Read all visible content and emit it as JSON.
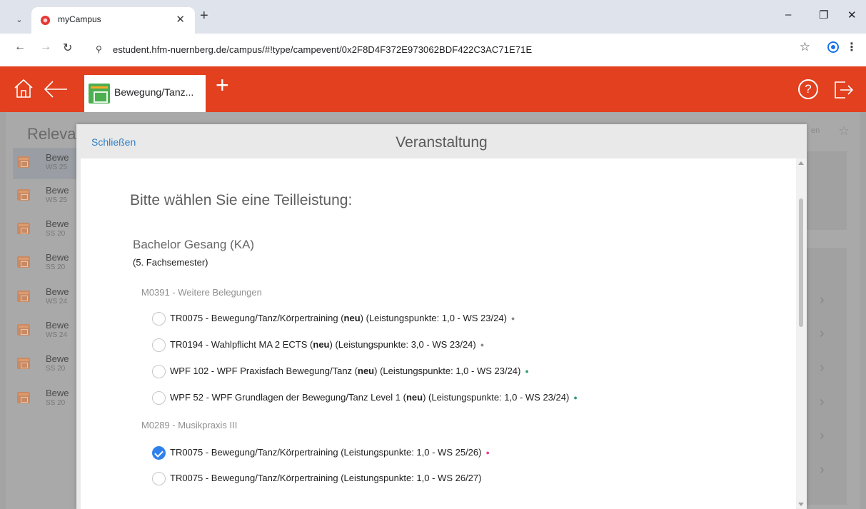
{
  "browser": {
    "tab_title": "myCampus",
    "tab_close": "✕",
    "new_tab": "+",
    "url": "estudent.hfm-nuernberg.de/campus/#!type/campevent/0x2F8D4F372E973062BDF422C3AC71E71E",
    "window_controls": {
      "minimize": "–",
      "restore": "❐",
      "close": "✕"
    },
    "icons": [
      "tab-search-icon",
      "favicon",
      "back-icon",
      "forward-icon",
      "reload-icon",
      "site-info-icon",
      "bookmark-star-icon",
      "profile-icon",
      "menu-icon"
    ]
  },
  "app_header": {
    "tab_label": "Bewegung/Tanz...",
    "add_label": "+",
    "help_label": "?",
    "accent": "#e2401f"
  },
  "background_page": {
    "title": "Releva",
    "items": [
      {
        "line1": "Bewe",
        "line2": "WS 25"
      },
      {
        "line1": "Bewe",
        "line2": "WS 25"
      },
      {
        "line1": "Bewe",
        "line2": "SS 20"
      },
      {
        "line1": "Bewe",
        "line2": "SS 20"
      },
      {
        "line1": "Bewe",
        "line2": "WS 24"
      },
      {
        "line1": "Bewe",
        "line2": "WS 24"
      },
      {
        "line1": "Bewe",
        "line2": "SS 20"
      },
      {
        "line1": "Bewe",
        "line2": "SS 20"
      }
    ],
    "right_hint": "en",
    "chevron": "›"
  },
  "modal": {
    "close_label": "Schließen",
    "title": "Veranstaltung",
    "prompt": "Bitte wählen Sie eine Teilleistung:",
    "program": "Bachelor Gesang (KA)",
    "semester": "(5. Fachsemester)",
    "modules": [
      {
        "label": "M0391 - Weitere Belegungen",
        "options": [
          {
            "prefix": "TR0075 - Bewegung/Tanz/Körpertraining ",
            "bold": "neu",
            "suffix": " (Leistungspunkte: 1,0 - WS 23/24)",
            "dot": "●",
            "dot_color": "#8a8a8a",
            "checked": false
          },
          {
            "prefix": "TR0194 - Wahlpflicht MA 2 ECTS ",
            "bold": "neu",
            "suffix": " (Leistungspunkte: 3,0 - WS 23/24)",
            "dot": "●",
            "dot_color": "#8a8a8a",
            "checked": false
          },
          {
            "prefix": "WPF 102 - WPF Praxisfach Bewegung/Tanz ",
            "bold": "neu",
            "suffix": " (Leistungspunkte: 1,0 - WS 23/24)",
            "dot": "●",
            "dot_color": "#2e9e6a",
            "checked": false
          },
          {
            "prefix": "WPF 52 - WPF Grundlagen der Bewegung/Tanz Level 1 ",
            "bold": "neu",
            "suffix": " (Leistungspunkte: 1,0 - WS 23/24)",
            "dot": "●",
            "dot_color": "#2e9e6a",
            "checked": false
          }
        ]
      },
      {
        "label": "M0289 - Musikpraxis III",
        "options": [
          {
            "prefix": "TR0075 - Bewegung/Tanz/Körpertraining (Leistungspunkte: 1,0 - WS 25/26)",
            "bold": "",
            "suffix": "",
            "dot": "●",
            "dot_color": "#e84393",
            "checked": true
          },
          {
            "prefix": "TR0075 - Bewegung/Tanz/Körpertraining (Leistungspunkte: 1,0 - WS 26/27)",
            "bold": "",
            "suffix": "",
            "dot": "",
            "dot_color": "#ffffff",
            "checked": false
          }
        ]
      }
    ]
  }
}
